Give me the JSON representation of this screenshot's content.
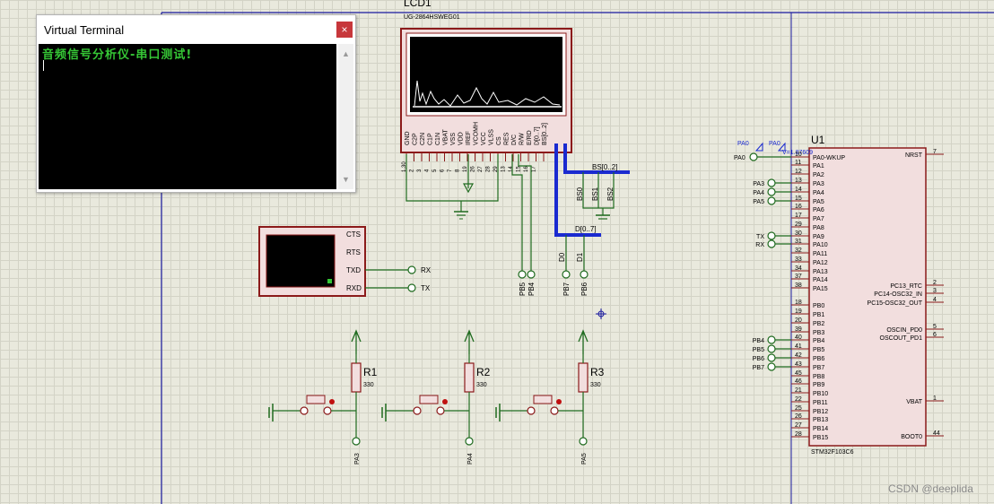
{
  "terminal": {
    "title": "Virtual Terminal",
    "close": "×",
    "text": "音频信号分析仪-串口测试!"
  },
  "lcd": {
    "ref": "LCD1",
    "part": "UG-2864HSWEG01",
    "pins": [
      "GND",
      "C2P",
      "C2N",
      "C1P",
      "C1N",
      "VBAT",
      "VSS",
      "VDD",
      "IREF",
      "VCOMH",
      "VCC",
      "VLSS",
      "CS",
      "RES",
      "D/C",
      "R/W",
      "E/RD",
      "D[0..7]",
      "BS[0..2]"
    ],
    "nums": [
      "1,30",
      "2",
      "3",
      "4",
      "5",
      "6",
      "7",
      "8",
      "19",
      "26",
      "27",
      "28",
      "29",
      "13",
      "14",
      "15",
      "16",
      "17"
    ]
  },
  "bus": {
    "bs": "BS[0..2]",
    "d": "D[0..7]",
    "bs0": "BS0",
    "bs1": "BS1",
    "bs2": "BS2",
    "d0": "D0",
    "d1": "D1"
  },
  "uart": {
    "cts": "CTS",
    "rts": "RTS",
    "txd": "TXD",
    "rxd": "RXD",
    "rx": "RX",
    "tx": "TX"
  },
  "mcu": {
    "ref": "U1",
    "part": "STM32F103C6",
    "probe": "PA0",
    "voltage": "V=1.87609",
    "pa0": "PA0",
    "left": [
      {
        "n": "10",
        "l": "PA0-WKUP"
      },
      {
        "n": "11",
        "l": "PA1"
      },
      {
        "n": "12",
        "l": "PA2"
      },
      {
        "n": "13",
        "l": "PA3"
      },
      {
        "n": "14",
        "l": "PA4"
      },
      {
        "n": "15",
        "l": "PA5"
      },
      {
        "n": "16",
        "l": "PA6"
      },
      {
        "n": "17",
        "l": "PA7"
      },
      {
        "n": "29",
        "l": "PA8"
      },
      {
        "n": "30",
        "l": "PA9"
      },
      {
        "n": "31",
        "l": "PA10"
      },
      {
        "n": "32",
        "l": "PA11"
      },
      {
        "n": "33",
        "l": "PA12"
      },
      {
        "n": "34",
        "l": "PA13"
      },
      {
        "n": "37",
        "l": "PA14"
      },
      {
        "n": "38",
        "l": "PA15"
      },
      {
        "n": "18",
        "l": "PB0"
      },
      {
        "n": "19",
        "l": "PB1"
      },
      {
        "n": "20",
        "l": "PB2"
      },
      {
        "n": "39",
        "l": "PB3"
      },
      {
        "n": "40",
        "l": "PB4"
      },
      {
        "n": "41",
        "l": "PB5"
      },
      {
        "n": "42",
        "l": "PB6"
      },
      {
        "n": "43",
        "l": "PB7"
      },
      {
        "n": "45",
        "l": "PB8"
      },
      {
        "n": "46",
        "l": "PB9"
      },
      {
        "n": "21",
        "l": "PB10"
      },
      {
        "n": "22",
        "l": "PB11"
      },
      {
        "n": "25",
        "l": "PB12"
      },
      {
        "n": "26",
        "l": "PB13"
      },
      {
        "n": "27",
        "l": "PB14"
      },
      {
        "n": "28",
        "l": "PB15"
      }
    ],
    "right": [
      {
        "n": "7",
        "l": "NRST"
      },
      {
        "n": "2",
        "l": "PC13_RTC"
      },
      {
        "n": "3",
        "l": "PC14-OSC32_IN"
      },
      {
        "n": "4",
        "l": "PC15-OSC32_OUT"
      },
      {
        "n": "5",
        "l": "OSCIN_PD0"
      },
      {
        "n": "6",
        "l": "OSCOUT_PD1"
      },
      {
        "n": "1",
        "l": "VBAT"
      },
      {
        "n": "44",
        "l": "BOOT0"
      }
    ],
    "terms": {
      "pa3": "PA3",
      "pa4": "PA4",
      "pa5": "PA5",
      "tx": "TX",
      "rx": "RX",
      "pb4": "PB4",
      "pb5": "PB5",
      "pb6": "PB6",
      "pb7": "PB7"
    }
  },
  "mid": {
    "pb5": "PB5",
    "pb4": "PB4",
    "pb7": "PB7",
    "pb6": "PB6"
  },
  "resistors": [
    {
      "ref": "R1",
      "val": "330",
      "port": "PA3"
    },
    {
      "ref": "R2",
      "val": "330",
      "port": "PA4"
    },
    {
      "ref": "R3",
      "val": "330",
      "port": "PA5"
    }
  ],
  "credit": "CSDN @deeplida"
}
